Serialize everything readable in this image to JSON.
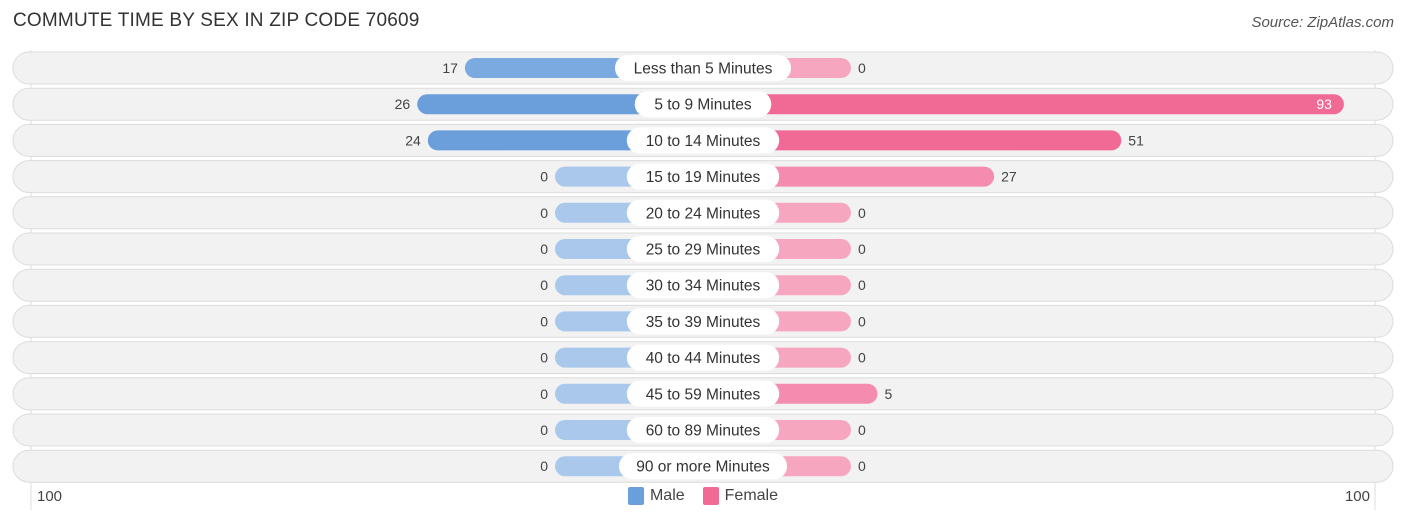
{
  "header": {
    "title": "COMMUTE TIME BY SEX IN ZIP CODE 70609",
    "source": "Source: ZipAtlas.com"
  },
  "colors": {
    "male": "#6a9fdc",
    "male_light": "#a9c8ec",
    "female": "#f06a95",
    "female_light": "#f7a6c0",
    "row_bg": "#f2f2f2"
  },
  "chart_data": {
    "type": "bar",
    "orientation": "horizontal-diverging",
    "title": "COMMUTE TIME BY SEX IN ZIP CODE 70609",
    "categories": [
      "Less than 5 Minutes",
      "5 to 9 Minutes",
      "10 to 14 Minutes",
      "15 to 19 Minutes",
      "20 to 24 Minutes",
      "25 to 29 Minutes",
      "30 to 34 Minutes",
      "35 to 39 Minutes",
      "40 to 44 Minutes",
      "45 to 59 Minutes",
      "60 to 89 Minutes",
      "90 or more Minutes"
    ],
    "series": [
      {
        "name": "Male",
        "side": "left",
        "values": [
          17,
          26,
          24,
          0,
          0,
          0,
          0,
          0,
          0,
          0,
          0,
          0
        ]
      },
      {
        "name": "Female",
        "side": "right",
        "values": [
          0,
          93,
          51,
          27,
          0,
          0,
          0,
          0,
          0,
          5,
          0,
          0
        ]
      }
    ],
    "axis": {
      "left_label": "100",
      "right_label": "100",
      "range": [
        0,
        100
      ]
    },
    "legend": {
      "position": "bottom-center",
      "entries": [
        "Male",
        "Female"
      ]
    }
  }
}
